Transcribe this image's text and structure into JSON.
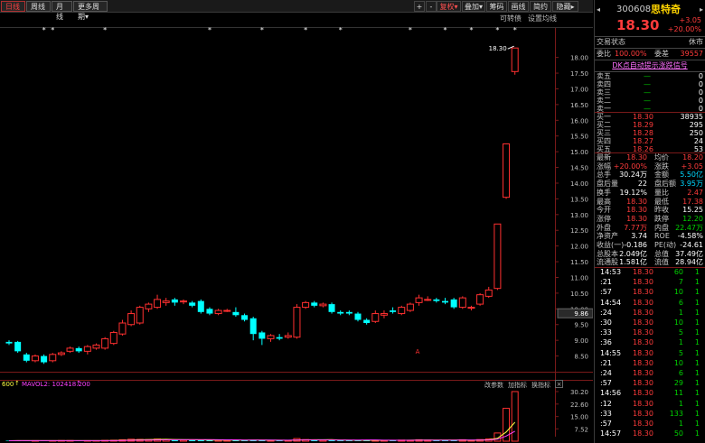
{
  "toolbar": {
    "tabs": [
      "日线",
      "周线",
      "月线",
      "更多周期"
    ],
    "right_buttons": [
      "+",
      "-",
      "",
      "",
      "复权",
      "叠加",
      "筹码",
      "画线",
      "简约",
      "隐藏"
    ],
    "more_arrow": "▾",
    "fq_arrow": "▾",
    "overlay_arrow": "▾",
    "hide_arrow": "▸"
  },
  "sub_header": {
    "convert_bond": "可转债",
    "ma_settings": "设置均线"
  },
  "chart_data": {
    "type": "candlestick",
    "price_axis": {
      "ticks": [
        "18.00",
        "17.50",
        "17.00",
        "16.50",
        "16.00",
        "15.50",
        "15.00",
        "14.50",
        "14.00",
        "13.50",
        "13.00",
        "12.50",
        "12.00",
        "11.50",
        "11.00",
        "10.50",
        "10.00",
        "9.50",
        "9.00",
        "8.50"
      ],
      "current": "9.86"
    },
    "max_label": "18.30",
    "candles": [
      {
        "o": 8.95,
        "c": 8.9,
        "h": 9.0,
        "l": 8.85
      },
      {
        "o": 8.95,
        "c": 8.65,
        "h": 8.98,
        "l": 8.6
      },
      {
        "o": 8.55,
        "c": 8.35,
        "h": 8.6,
        "l": 8.3
      },
      {
        "o": 8.35,
        "c": 8.5,
        "h": 8.55,
        "l": 8.3
      },
      {
        "o": 8.5,
        "c": 8.3,
        "h": 8.55,
        "l": 8.25
      },
      {
        "o": 8.35,
        "c": 8.55,
        "h": 8.6,
        "l": 8.3
      },
      {
        "o": 8.55,
        "c": 8.6,
        "h": 8.65,
        "l": 8.5
      },
      {
        "o": 8.65,
        "c": 8.75,
        "h": 8.8,
        "l": 8.6
      },
      {
        "o": 8.75,
        "c": 8.65,
        "h": 8.8,
        "l": 8.6
      },
      {
        "o": 8.65,
        "c": 8.8,
        "h": 8.85,
        "l": 8.55
      },
      {
        "o": 8.75,
        "c": 8.85,
        "h": 8.9,
        "l": 8.7
      },
      {
        "o": 8.75,
        "c": 9.05,
        "h": 9.1,
        "l": 8.7
      },
      {
        "o": 8.9,
        "c": 9.25,
        "h": 9.3,
        "l": 8.85
      },
      {
        "o": 9.2,
        "c": 9.55,
        "h": 9.65,
        "l": 9.15
      },
      {
        "o": 9.5,
        "c": 9.85,
        "h": 9.95,
        "l": 9.45
      },
      {
        "o": 9.55,
        "c": 10.05,
        "h": 10.1,
        "l": 9.5
      },
      {
        "o": 10.0,
        "c": 10.15,
        "h": 10.2,
        "l": 9.9
      },
      {
        "o": 10.05,
        "c": 10.3,
        "h": 10.45,
        "l": 10.0
      },
      {
        "o": 10.2,
        "c": 10.25,
        "h": 10.35,
        "l": 10.1
      },
      {
        "o": 10.3,
        "c": 10.2,
        "h": 10.35,
        "l": 10.1
      },
      {
        "o": 10.25,
        "c": 10.25,
        "h": 10.3,
        "l": 10.15
      },
      {
        "o": 10.2,
        "c": 10.1,
        "h": 10.25,
        "l": 10.05
      },
      {
        "o": 10.25,
        "c": 9.9,
        "h": 10.3,
        "l": 9.85
      },
      {
        "o": 10.0,
        "c": 9.85,
        "h": 10.05,
        "l": 9.8
      },
      {
        "o": 9.85,
        "c": 9.95,
        "h": 10.0,
        "l": 9.8
      },
      {
        "o": 9.95,
        "c": 9.95,
        "h": 10.0,
        "l": 9.9
      },
      {
        "o": 9.9,
        "c": 9.8,
        "h": 10.05,
        "l": 9.75
      },
      {
        "o": 9.8,
        "c": 9.65,
        "h": 9.85,
        "l": 9.6
      },
      {
        "o": 9.7,
        "c": 9.2,
        "h": 9.75,
        "l": 9.0
      },
      {
        "o": 9.25,
        "c": 9.05,
        "h": 9.3,
        "l": 8.85
      },
      {
        "o": 9.05,
        "c": 9.15,
        "h": 9.2,
        "l": 8.95
      },
      {
        "o": 9.1,
        "c": 9.05,
        "h": 9.2,
        "l": 9.0
      },
      {
        "o": 9.1,
        "c": 9.15,
        "h": 9.25,
        "l": 9.05
      },
      {
        "o": 9.1,
        "c": 10.05,
        "h": 10.15,
        "l": 9.05
      },
      {
        "o": 10.05,
        "c": 10.2,
        "h": 10.25,
        "l": 10.0
      },
      {
        "o": 10.2,
        "c": 10.1,
        "h": 10.25,
        "l": 10.05
      },
      {
        "o": 10.1,
        "c": 10.15,
        "h": 10.2,
        "l": 10.05
      },
      {
        "o": 10.15,
        "c": 9.9,
        "h": 10.2,
        "l": 9.85
      },
      {
        "o": 9.9,
        "c": 9.85,
        "h": 9.95,
        "l": 9.8
      },
      {
        "o": 9.9,
        "c": 9.85,
        "h": 9.95,
        "l": 9.8
      },
      {
        "o": 9.85,
        "c": 9.65,
        "h": 9.9,
        "l": 9.6
      },
      {
        "o": 9.65,
        "c": 9.55,
        "h": 9.7,
        "l": 9.5
      },
      {
        "o": 9.6,
        "c": 9.85,
        "h": 9.95,
        "l": 9.55
      },
      {
        "o": 9.8,
        "c": 9.85,
        "h": 9.95,
        "l": 9.7
      },
      {
        "o": 9.95,
        "c": 9.9,
        "h": 10.05,
        "l": 9.85
      },
      {
        "o": 9.85,
        "c": 10.05,
        "h": 10.1,
        "l": 9.8
      },
      {
        "o": 9.95,
        "c": 10.15,
        "h": 10.2,
        "l": 9.9
      },
      {
        "o": 10.2,
        "c": 10.35,
        "h": 10.45,
        "l": 10.1
      },
      {
        "o": 10.3,
        "c": 10.3,
        "h": 10.4,
        "l": 10.25
      },
      {
        "o": 10.3,
        "c": 10.25,
        "h": 10.35,
        "l": 10.2
      },
      {
        "o": 10.25,
        "c": 10.2,
        "h": 10.35,
        "l": 10.15
      },
      {
        "o": 10.3,
        "c": 10.05,
        "h": 10.35,
        "l": 10.0
      },
      {
        "o": 10.05,
        "c": 10.35,
        "h": 10.4,
        "l": 10.0
      },
      {
        "o": 10.05,
        "c": 10.05,
        "h": 10.1,
        "l": 9.95
      },
      {
        "o": 10.15,
        "c": 10.45,
        "h": 10.5,
        "l": 10.1
      },
      {
        "o": 10.4,
        "c": 10.6,
        "h": 10.7,
        "l": 10.35
      },
      {
        "o": 10.65,
        "c": 12.7,
        "h": 12.7,
        "l": 10.6
      },
      {
        "o": 13.55,
        "c": 15.25,
        "h": 15.25,
        "l": 13.5
      },
      {
        "o": 17.55,
        "c": 18.3,
        "h": 18.3,
        "l": 17.45
      }
    ],
    "volume_axis": [
      "30.20",
      "22.60",
      "15.00",
      "7.52"
    ],
    "volumes": [
      0.3,
      0.4,
      0.4,
      0.3,
      0.3,
      0.3,
      0.4,
      0.4,
      0.3,
      0.3,
      0.3,
      0.5,
      0.6,
      0.9,
      1.2,
      1.1,
      1.0,
      1.3,
      1.1,
      0.8,
      0.7,
      0.7,
      0.8,
      0.6,
      0.7,
      0.6,
      0.6,
      0.6,
      0.9,
      0.6,
      0.5,
      0.4,
      0.5,
      1.6,
      1.0,
      0.8,
      0.7,
      0.6,
      0.5,
      0.5,
      0.6,
      0.5,
      0.6,
      0.5,
      0.6,
      0.7,
      0.6,
      0.9,
      0.7,
      0.6,
      0.6,
      0.6,
      0.9,
      0.5,
      1.0,
      1.4,
      5.0,
      20.0,
      30.2
    ],
    "volume_series": [
      "MAVOL1:600",
      "MAVOL2:102418.200"
    ]
  },
  "vol_header": {
    "vol": "600",
    "mavol2": "MAVOL2: 102418.200",
    "up": "↑",
    "params": "改参数",
    "add": "加指标",
    "swap": "换指标",
    "close": "×"
  },
  "marker": "A",
  "quote": {
    "code": "300608",
    "name": "思特奇",
    "price": "18.30",
    "change": "+3.05",
    "change_pct": "+20.00%",
    "status_label": "交易状态",
    "status": "休市",
    "wb_label": "委比",
    "wb": "100.00%",
    "wc_label": "委差",
    "wc": "39557",
    "dk_signal": "DK点自动提示涨跌信号",
    "asks": [
      {
        "label": "卖五",
        "price": "—",
        "vol": "0"
      },
      {
        "label": "卖四",
        "price": "—",
        "vol": "0"
      },
      {
        "label": "卖三",
        "price": "—",
        "vol": "0"
      },
      {
        "label": "卖二",
        "price": "—",
        "vol": "0"
      },
      {
        "label": "卖一",
        "price": "—",
        "vol": "0"
      }
    ],
    "bids": [
      {
        "label": "买一",
        "price": "18.30",
        "vol": "38935"
      },
      {
        "label": "买二",
        "price": "18.29",
        "vol": "295"
      },
      {
        "label": "买三",
        "price": "18.28",
        "vol": "250"
      },
      {
        "label": "买四",
        "price": "18.27",
        "vol": "24"
      },
      {
        "label": "买五",
        "price": "18.26",
        "vol": "53"
      }
    ],
    "stats": [
      {
        "l1": "最新",
        "v1": "18.30",
        "c1": "red",
        "l2": "均价",
        "v2": "18.20",
        "c2": "red"
      },
      {
        "l1": "涨幅",
        "v1": "+20.00%",
        "c1": "red",
        "l2": "涨跌",
        "v2": "+3.05",
        "c2": "red"
      },
      {
        "l1": "总手",
        "v1": "30.24万",
        "c1": "white",
        "l2": "金额",
        "v2": "5.50亿",
        "c2": "cyan"
      },
      {
        "l1": "盘后量",
        "v1": "22",
        "c1": "white",
        "l2": "盘后额",
        "v2": "3.95万",
        "c2": "cyan"
      },
      {
        "l1": "换手",
        "v1": "19.12%",
        "c1": "white",
        "l2": "量比",
        "v2": "2.47",
        "c2": "red"
      },
      {
        "l1": "最高",
        "v1": "18.30",
        "c1": "red",
        "l2": "最低",
        "v2": "17.38",
        "c2": "red"
      },
      {
        "l1": "今开",
        "v1": "18.30",
        "c1": "red",
        "l2": "昨收",
        "v2": "15.25",
        "c2": "white"
      },
      {
        "l1": "涨停",
        "v1": "18.30",
        "c1": "red",
        "l2": "跌停",
        "v2": "12.20",
        "c2": "green"
      },
      {
        "l1": "外盘",
        "v1": "7.77万",
        "c1": "red",
        "l2": "内盘",
        "v2": "22.47万",
        "c2": "green"
      },
      {
        "l1": "净资产",
        "v1": "3.74",
        "c1": "white",
        "l2": "ROE",
        "v2": "-4.58%",
        "c2": "white"
      },
      {
        "l1": "收益(一)",
        "v1": "-0.186",
        "c1": "white",
        "l2": "PE(动)",
        "v2": "-24.61",
        "c2": "white"
      },
      {
        "l1": "总股本",
        "v1": "2.049亿",
        "c1": "white",
        "l2": "总值",
        "v2": "37.49亿",
        "c2": "white"
      },
      {
        "l1": "流通股",
        "v1": "1.581亿",
        "c1": "white",
        "l2": "流值",
        "v2": "28.94亿",
        "c2": "white"
      }
    ],
    "ticks": [
      {
        "t": "14:53",
        "p": "18.30",
        "v": "60",
        "n": "1",
        "vc": "green"
      },
      {
        "t": ":21",
        "p": "18.30",
        "v": "7",
        "n": "1",
        "vc": "green"
      },
      {
        "t": ":57",
        "p": "18.30",
        "v": "10",
        "n": "1",
        "vc": "green"
      },
      {
        "t": "14:54",
        "p": "18.30",
        "v": "6",
        "n": "1",
        "vc": "green"
      },
      {
        "t": ":24",
        "p": "18.30",
        "v": "1",
        "n": "1",
        "vc": "green"
      },
      {
        "t": ":30",
        "p": "18.30",
        "v": "10",
        "n": "1",
        "vc": "green"
      },
      {
        "t": ":33",
        "p": "18.30",
        "v": "5",
        "n": "1",
        "vc": "green"
      },
      {
        "t": ":36",
        "p": "18.30",
        "v": "1",
        "n": "1",
        "vc": "green"
      },
      {
        "t": "14:55",
        "p": "18.30",
        "v": "5",
        "n": "1",
        "vc": "green"
      },
      {
        "t": ":21",
        "p": "18.30",
        "v": "10",
        "n": "1",
        "vc": "green"
      },
      {
        "t": ":24",
        "p": "18.30",
        "v": "6",
        "n": "1",
        "vc": "green"
      },
      {
        "t": ":57",
        "p": "18.30",
        "v": "29",
        "n": "1",
        "vc": "green"
      },
      {
        "t": "14:56",
        "p": "18.30",
        "v": "11",
        "n": "1",
        "vc": "green"
      },
      {
        "t": ":12",
        "p": "18.30",
        "v": "1",
        "n": "1",
        "vc": "green"
      },
      {
        "t": ":33",
        "p": "18.30",
        "v": "133",
        "n": "1",
        "vc": "green"
      },
      {
        "t": ":57",
        "p": "18.30",
        "v": "1",
        "n": "1",
        "vc": "green"
      },
      {
        "t": "14:57",
        "p": "18.30",
        "v": "50",
        "n": "1",
        "vc": "green"
      }
    ],
    "nav_left": "◂",
    "nav_right": "▸"
  }
}
